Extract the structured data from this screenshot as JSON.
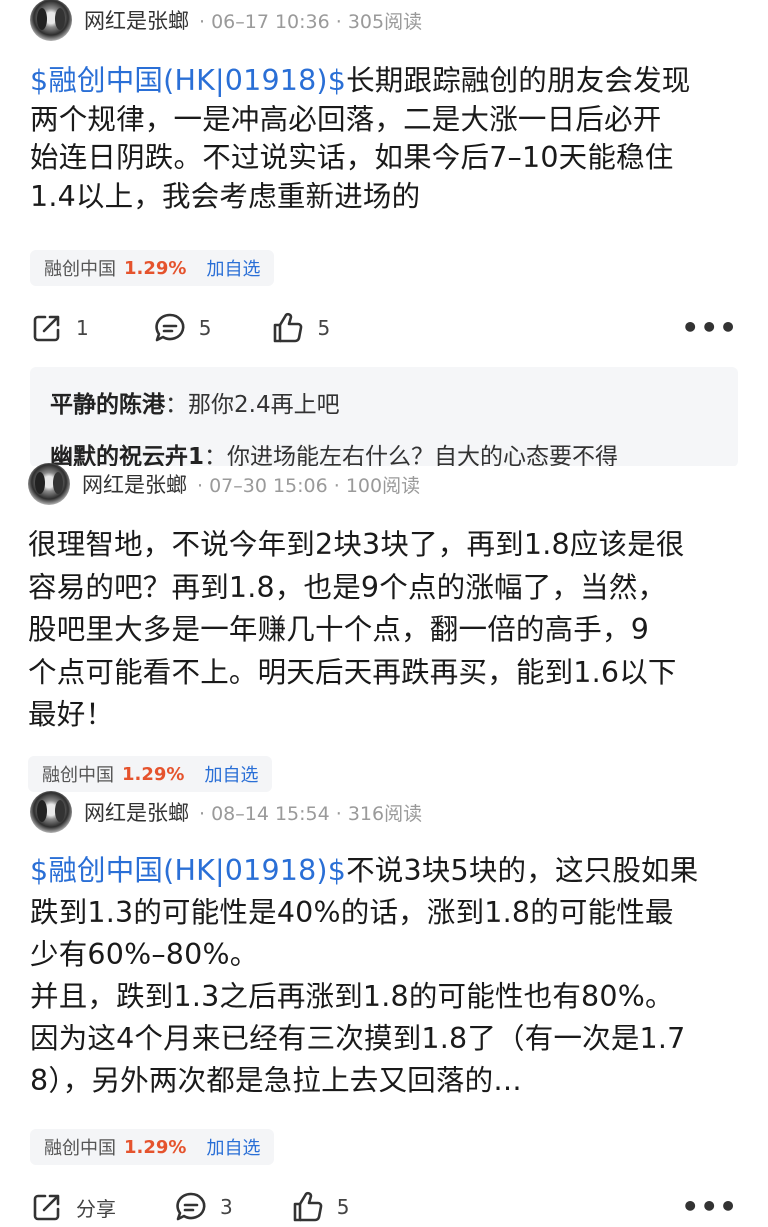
{
  "posts": [
    {
      "author": "网红是张螂",
      "meta": "· 06–17 10:36 · 305阅读",
      "lines": [
        {
          "tag": "$融创中国(HK|01918)$",
          "text": "长期跟踪融创的朋友会发现"
        },
        {
          "text": "两个规律，一是冲高必回落，二是大涨一日后必开"
        },
        {
          "text": "始连日阴跌。不过说实话，如果今后7–10天能稳住"
        },
        {
          "text": "1.4以上，我会考虑重新进场的"
        }
      ],
      "stock": {
        "name": "融创中国",
        "change": "1.29%",
        "add": "加自选"
      },
      "actions": {
        "share": "1",
        "comment": "5",
        "like": "5",
        "more": "•••"
      },
      "replies": [
        {
          "name": "平静的陈港",
          "text": "：那你2.4再上吧"
        },
        {
          "name": "幽默的祝云卉1",
          "text": "：你进场能左右什么？自大的心态要不得"
        }
      ]
    },
    {
      "author": "网红是张螂",
      "meta": "· 07–30 15:06 · 100阅读",
      "lines": [
        {
          "text": "很理智地，不说今年到2块3块了，再到1.8应该是很"
        },
        {
          "text": "容易的吧？再到1.8，也是9个点的涨幅了，当然，"
        },
        {
          "text": "股吧里大多是一年赚几十个点，翻一倍的高手，9"
        },
        {
          "text": "个点可能看不上。明天后天再跌再买，能到1.6以下"
        },
        {
          "text": "最好！"
        }
      ],
      "stock": {
        "name": "融创中国",
        "change": "1.29%",
        "add": "加自选"
      }
    },
    {
      "author": "网红是张螂",
      "meta": "· 08–14 15:54 · 316阅读",
      "lines": [
        {
          "tag": "$融创中国(HK|01918)$",
          "text": "不说3块5块的，这只股如果"
        },
        {
          "text": "跌到1.3的可能性是40%的话，涨到1.8的可能性最"
        },
        {
          "text": "少有60%–80%。"
        },
        {
          "text": "并且，跌到1.3之后再涨到1.8的可能性也有80%。"
        },
        {
          "text": "因为这4个月来已经有三次摸到1.8了（有一次是1.7"
        },
        {
          "text": "8），另外两次都是急拉上去又回落的…"
        }
      ],
      "stock": {
        "name": "融创中国",
        "change": "1.29%",
        "add": "加自选"
      },
      "actions": {
        "share": "分享",
        "comment": "3",
        "like": "5",
        "more": "•••"
      }
    }
  ],
  "colors": {
    "link": "#2a6fd6",
    "up": "#e5532d",
    "meta": "#9a9a9a"
  }
}
